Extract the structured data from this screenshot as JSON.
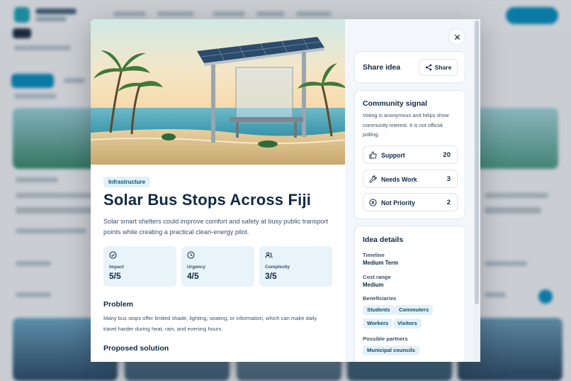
{
  "idea": {
    "category": "Infrastructure",
    "title": "Solar Bus Stops Across Fiji",
    "summary": "Solar smart shelters could improve comfort and safety at busy public transport points while creating a practical clean-energy pilot.",
    "metrics": [
      {
        "label": "Impact",
        "value": "5/5",
        "icon": "check-circle-icon"
      },
      {
        "label": "Urgency",
        "value": "4/5",
        "icon": "clock-icon"
      },
      {
        "label": "Complexity",
        "value": "3/5",
        "icon": "people-icon"
      }
    ],
    "problem": {
      "title": "Problem",
      "text": "Many bus stops offer limited shade, lighting, seating, or information, which can make daily travel harder during heat, rain, and evening hours."
    },
    "solution": {
      "title": "Proposed solution",
      "text": ""
    }
  },
  "share": {
    "title": "Share idea",
    "button_label": "Share"
  },
  "signal": {
    "title": "Community signal",
    "note": "Voting is anonymous and helps show community interest. It is not official polling.",
    "votes": [
      {
        "label": "Support",
        "count": "20",
        "icon": "thumbs-up-icon"
      },
      {
        "label": "Needs Work",
        "count": "3",
        "icon": "wrench-icon"
      },
      {
        "label": "Not Priority",
        "count": "2",
        "icon": "not-priority-icon"
      }
    ]
  },
  "details": {
    "title": "Idea details",
    "timeline_label": "Timeline",
    "timeline_value": "Medium Term",
    "cost_label": "Cost range",
    "cost_value": "Medium",
    "beneficiaries_label": "Beneficiaries",
    "beneficiaries": [
      "Students",
      "Commuters",
      "Workers",
      "Visitors"
    ],
    "partners_label": "Possible partners",
    "partners": [
      "Municipal councils"
    ]
  },
  "colors": {
    "accent": "#0a8fc2",
    "badge_bg": "#dff1fb",
    "metric_bg": "#e8f3fa",
    "text_dark": "#0f2a44",
    "text_muted": "#3a5169"
  }
}
